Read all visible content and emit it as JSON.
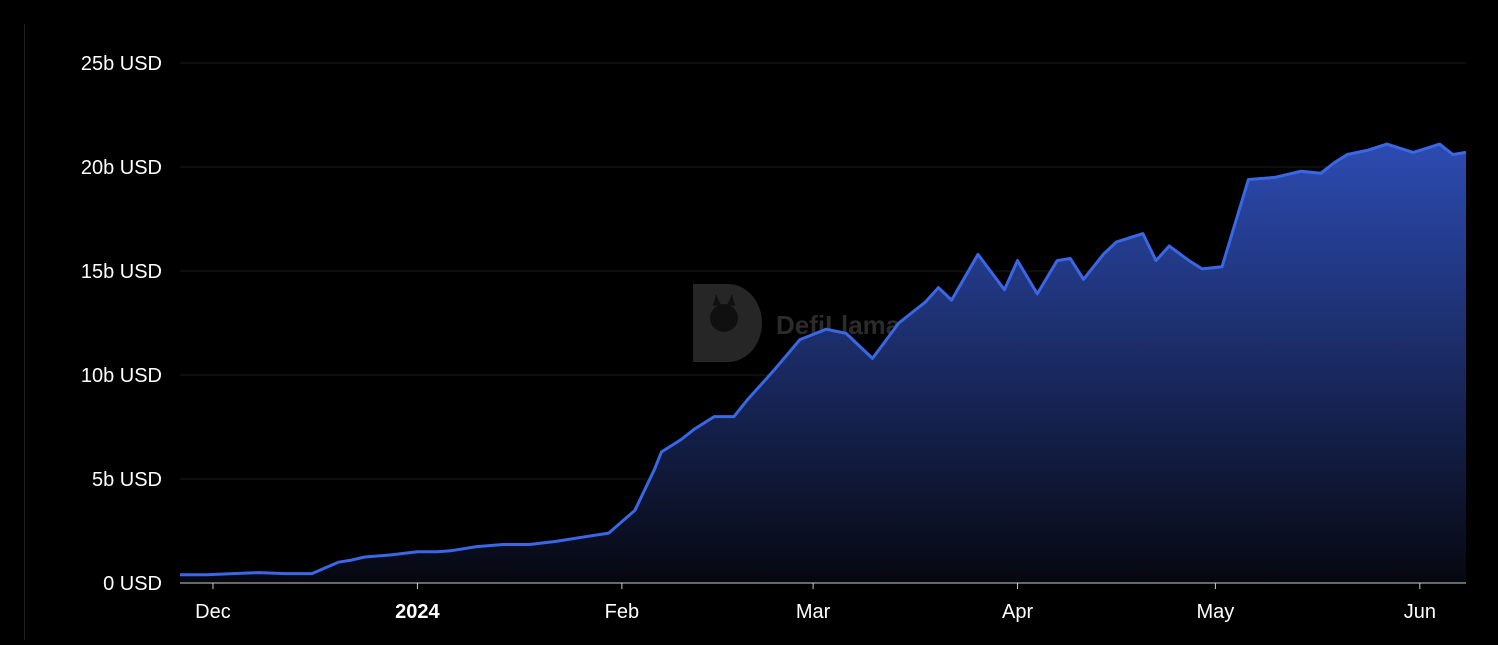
{
  "chart_data": {
    "type": "area",
    "title": "",
    "xlabel": "",
    "ylabel": "",
    "y_ticks": [
      "0 USD",
      "5b USD",
      "10b USD",
      "15b USD",
      "20b USD",
      "25b USD"
    ],
    "ylim": [
      0,
      25
    ],
    "y_unit": "b USD",
    "x_ticks": [
      {
        "label": "Dec",
        "date": "2023-12-01",
        "bold": false
      },
      {
        "label": "2024",
        "date": "2024-01-01",
        "bold": true
      },
      {
        "label": "Feb",
        "date": "2024-02-01",
        "bold": false
      },
      {
        "label": "Mar",
        "date": "2024-03-01",
        "bold": false
      },
      {
        "label": "Apr",
        "date": "2024-04-01",
        "bold": false
      },
      {
        "label": "May",
        "date": "2024-05-01",
        "bold": false
      },
      {
        "label": "Jun",
        "date": "2024-06-01",
        "bold": false
      }
    ],
    "xlim": [
      "2023-11-26",
      "2024-06-08"
    ],
    "grid": true,
    "colors": {
      "line": "#3a67e6",
      "area_top": "#2f4fba",
      "area_bottom": "#06070f",
      "grid": "#1c1c1c",
      "text": "#ffffff"
    },
    "watermark": "DefiLlama",
    "series": [
      {
        "x": [
          "2023-11-26",
          "2023-11-30",
          "2023-12-04",
          "2023-12-08",
          "2023-12-12",
          "2023-12-16",
          "2023-12-20",
          "2023-12-22",
          "2023-12-24",
          "2023-12-28",
          "2024-01-01",
          "2024-01-04",
          "2024-01-06",
          "2024-01-10",
          "2024-01-14",
          "2024-01-18",
          "2024-01-22",
          "2024-01-26",
          "2024-01-30",
          "2024-02-03",
          "2024-02-06",
          "2024-02-07",
          "2024-02-10",
          "2024-02-12",
          "2024-02-15",
          "2024-02-18",
          "2024-02-20",
          "2024-02-24",
          "2024-02-28",
          "2024-03-03",
          "2024-03-06",
          "2024-03-10",
          "2024-03-14",
          "2024-03-18",
          "2024-03-20",
          "2024-03-22",
          "2024-03-26",
          "2024-03-30",
          "2024-04-01",
          "2024-04-04",
          "2024-04-07",
          "2024-04-09",
          "2024-04-11",
          "2024-04-14",
          "2024-04-16",
          "2024-04-20",
          "2024-04-22",
          "2024-04-24",
          "2024-04-27",
          "2024-04-29",
          "2024-05-02",
          "2024-05-06",
          "2024-05-10",
          "2024-05-14",
          "2024-05-17",
          "2024-05-19",
          "2024-05-21",
          "2024-05-24",
          "2024-05-27",
          "2024-05-31",
          "2024-06-02",
          "2024-06-04",
          "2024-06-06",
          "2024-06-08"
        ],
        "values": [
          0.4,
          0.4,
          0.45,
          0.5,
          0.45,
          0.45,
          1.0,
          1.1,
          1.25,
          1.35,
          1.5,
          1.5,
          1.55,
          1.75,
          1.85,
          1.85,
          2.0,
          2.2,
          2.4,
          3.5,
          5.5,
          6.3,
          6.9,
          7.4,
          8.0,
          8.0,
          8.8,
          10.2,
          11.7,
          12.2,
          12.0,
          10.8,
          12.5,
          13.5,
          14.2,
          13.6,
          15.8,
          14.1,
          15.5,
          13.9,
          15.5,
          15.6,
          14.6,
          15.8,
          16.4,
          16.8,
          15.5,
          16.2,
          15.5,
          15.1,
          15.2,
          19.4,
          19.5,
          19.8,
          19.7,
          20.2,
          20.6,
          20.8,
          21.1,
          20.7,
          20.9,
          21.1,
          20.6,
          20.7
        ]
      }
    ]
  }
}
